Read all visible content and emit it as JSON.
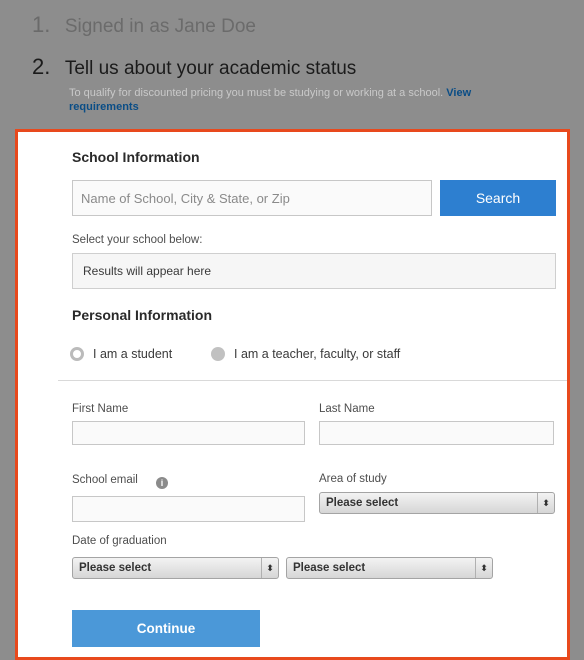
{
  "steps": [
    {
      "number": "1.",
      "text": "Signed in as Jane Doe"
    },
    {
      "number": "2.",
      "text": "Tell us about your academic status"
    }
  ],
  "step2_sub": {
    "text": "To qualify for discounted pricing you must be studying or working at a school.",
    "link": "View requirements"
  },
  "school": {
    "title": "School Information",
    "search_placeholder": "Name of School, City & State, or Zip",
    "search_button": "Search",
    "select_label": "Select your school below:",
    "results_text": "Results will appear here"
  },
  "personal": {
    "title": "Personal Information",
    "radio_student": "I am a student",
    "radio_teacher": "I am a teacher, faculty, or staff",
    "first_name_label": "First Name",
    "last_name_label": "Last Name",
    "school_email_label": "School email",
    "area_of_study_label": "Area of study",
    "area_select": "Please select",
    "date_grad_label": "Date of graduation",
    "grad_month_select": "Please select",
    "grad_year_select": "Please select",
    "info_symbol": "i",
    "select_arrows": "⬍"
  },
  "continue_button": "Continue",
  "colors": {
    "accent_border": "#e8491d",
    "search_button": "#2d7fd0",
    "continue_button": "#4b98d8",
    "link": "#0a4d86"
  }
}
